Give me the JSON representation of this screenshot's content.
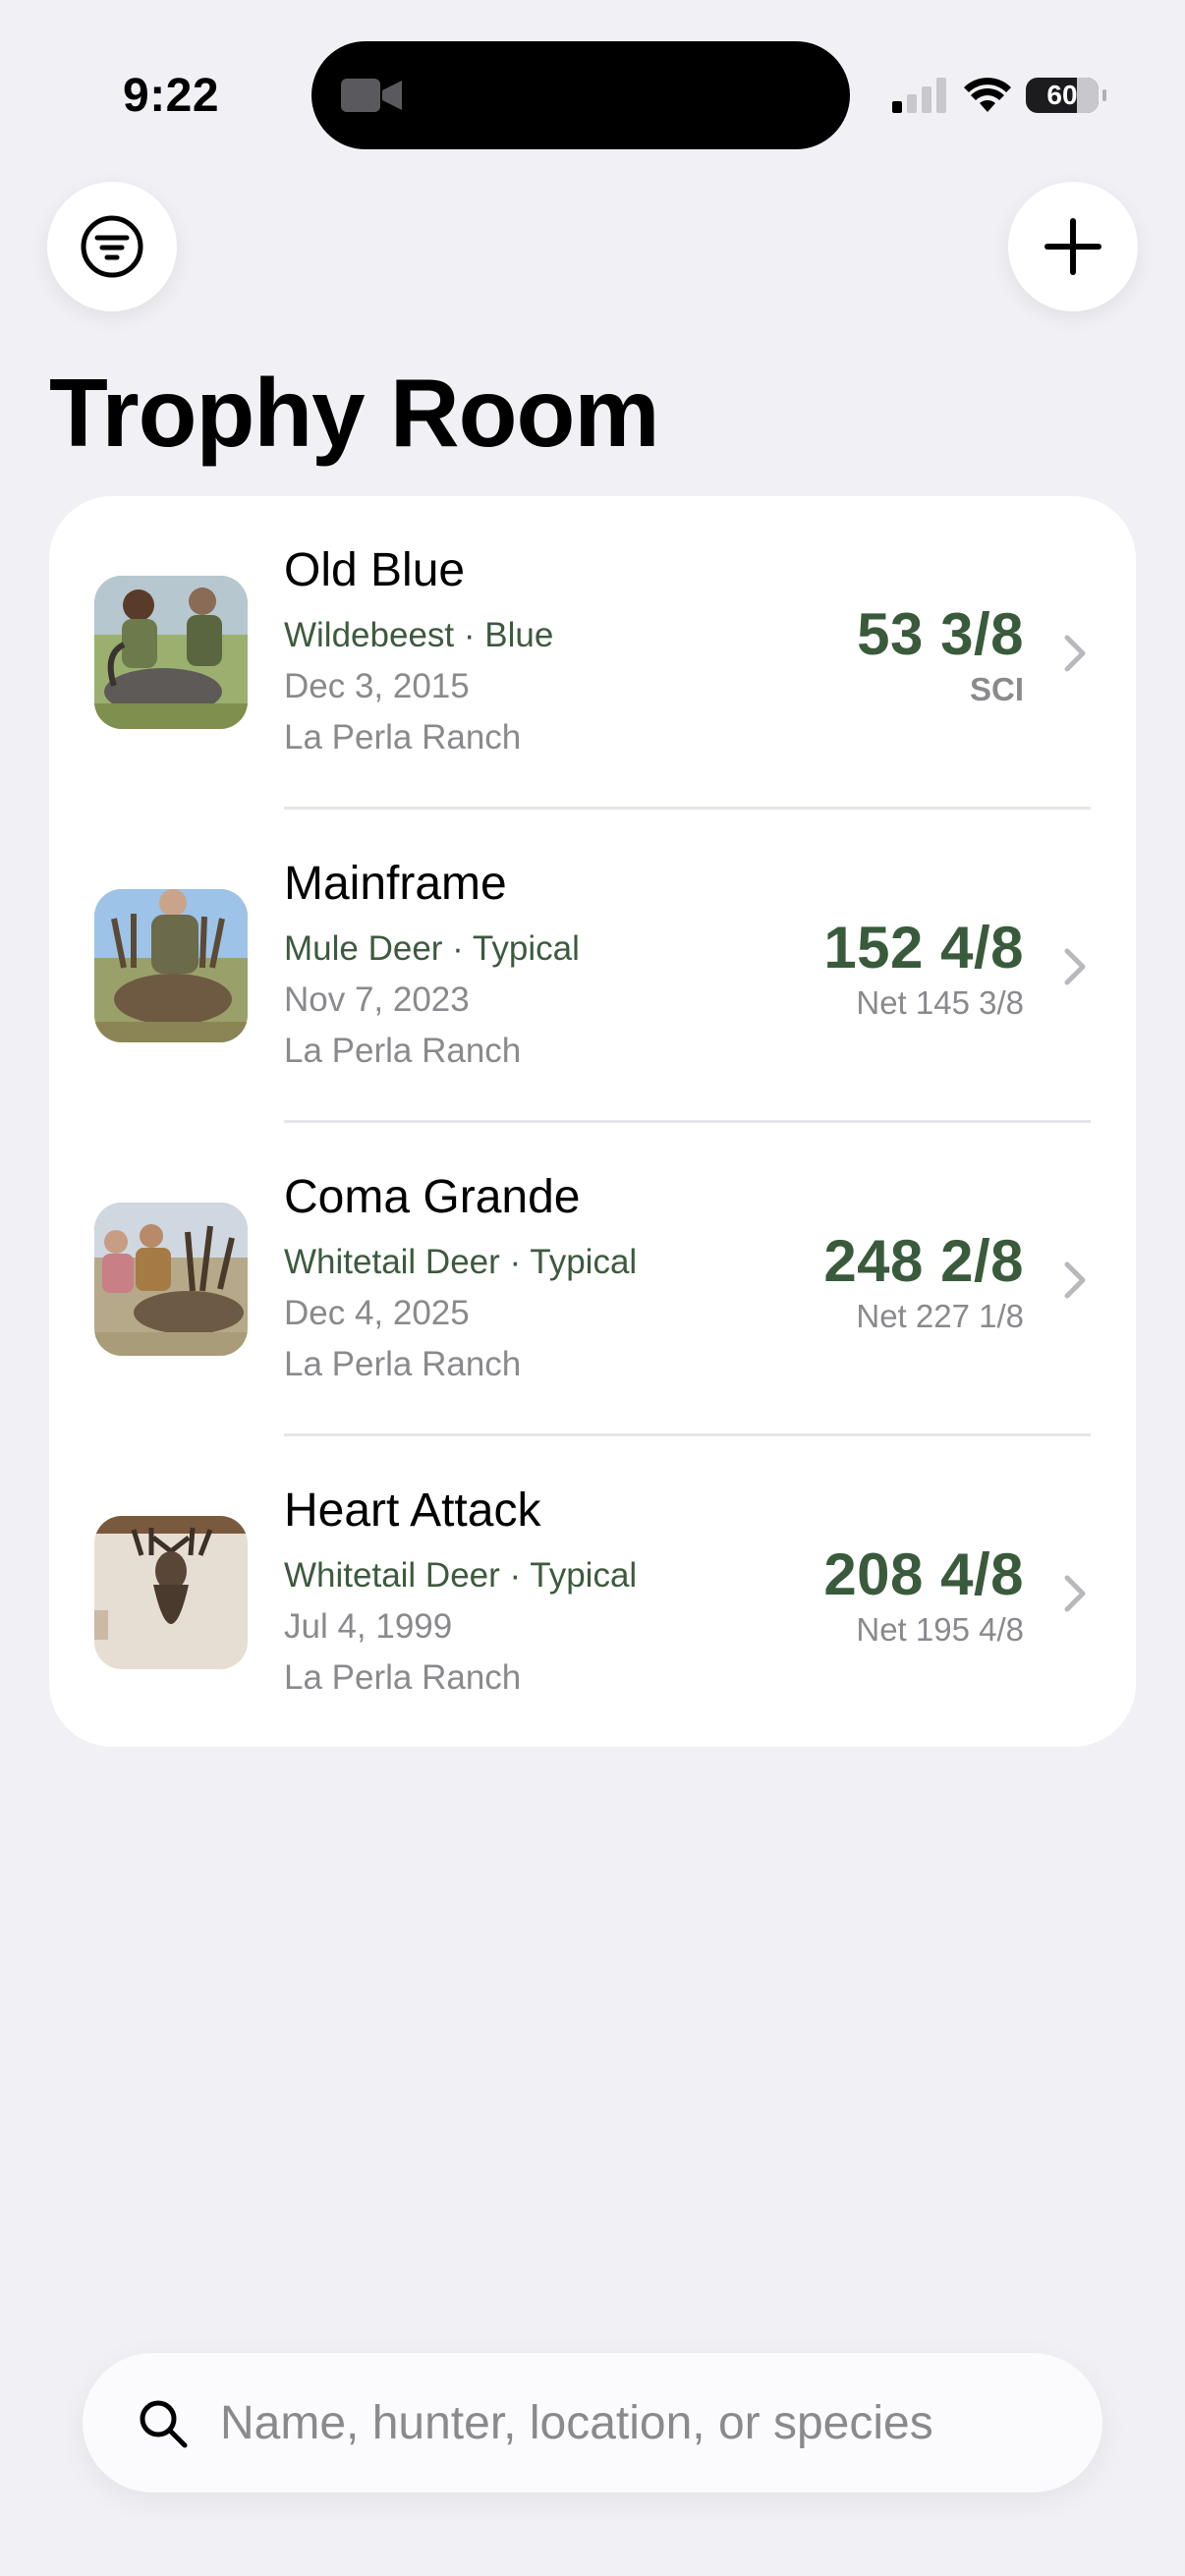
{
  "status_bar": {
    "time": "9:22",
    "battery": "60"
  },
  "header": {
    "title": "Trophy Room",
    "filter_icon": "filter-lines-icon",
    "add_icon": "plus-icon"
  },
  "trophies": [
    {
      "name": "Old Blue",
      "species": "Wildebeest · Blue",
      "date": "Dec 3, 2015",
      "location": "La Perla Ranch",
      "score": "53 3/8",
      "subscore": "SCI"
    },
    {
      "name": "Mainframe",
      "species": "Mule Deer · Typical",
      "date": "Nov 7, 2023",
      "location": "La Perla Ranch",
      "score": "152 4/8",
      "subscore": "Net 145 3/8"
    },
    {
      "name": "Coma Grande",
      "species": "Whitetail Deer · Typical",
      "date": "Dec 4, 2025",
      "location": "La Perla Ranch",
      "score": "248 2/8",
      "subscore": "Net 227 1/8"
    },
    {
      "name": "Heart Attack",
      "species": "Whitetail Deer · Typical",
      "date": "Jul 4, 1999",
      "location": "La Perla Ranch",
      "score": "208 4/8",
      "subscore": "Net 195 4/8"
    }
  ],
  "search": {
    "placeholder": "Name, hunter, location, or species",
    "value": ""
  },
  "colors": {
    "accent": "#3a5a3c",
    "background": "#f0f0f5",
    "secondary_text": "#8a8a8e"
  }
}
